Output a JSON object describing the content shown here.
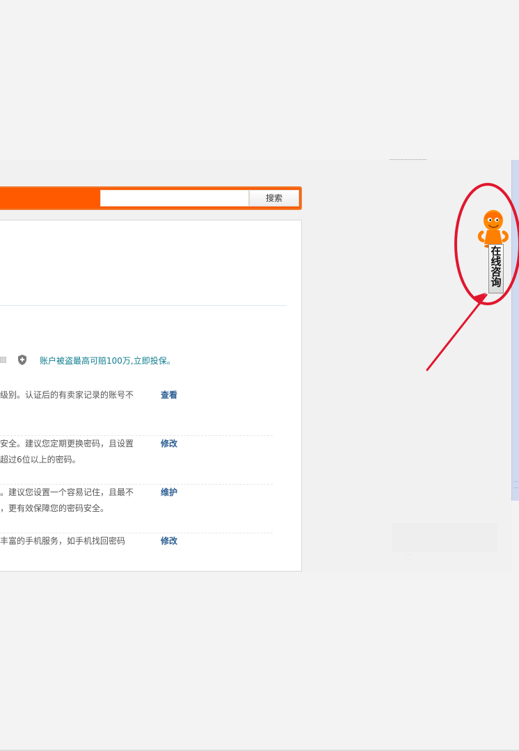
{
  "search": {
    "placeholder": "",
    "button_label": "搜索"
  },
  "security_panel": {
    "insurance_text": "账户被盗最高可赔100万,立即投保。",
    "rows": [
      {
        "line1": "级别。认证后的有卖家记录的账号不",
        "line2": "",
        "action": "查看"
      },
      {
        "line1": "安全。建议您定期更换密码，且设置",
        "line2": "超过6位以上的密码。",
        "action": "修改"
      },
      {
        "line1": "。建议您设置一个容易记住，且最不",
        "line2": "，更有效保障您的密码安全。",
        "action": "维护"
      },
      {
        "line1": "丰富的手机服务，如手机找回密码",
        "line2": "",
        "action": "修改"
      }
    ]
  },
  "consult_widget": {
    "label_chars": [
      "在",
      "线",
      "咨",
      "询"
    ],
    "icon": "orange-mascot-icon",
    "accent": "#ff7a00"
  },
  "colors": {
    "search_bar": "#ff5a00",
    "link_teal": "#0f7d8f",
    "action_blue": "#2d5f93",
    "annotation_red": "#e1162e",
    "scrollbar": "#cfd9ef"
  }
}
